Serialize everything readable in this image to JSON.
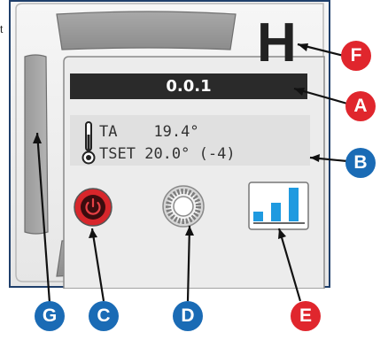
{
  "edge_text": "t",
  "display": {
    "title": "0.0.1",
    "mode_letter": "H",
    "sensors": {
      "ta_label": "TA",
      "ta_value": "19.4°",
      "tset_label": "TSET",
      "tset_value": "20.0°",
      "tset_offset": "(-4)"
    },
    "signal_bars": 3
  },
  "callouts": {
    "a": "A",
    "b": "B",
    "c": "C",
    "d": "D",
    "e": "E",
    "f": "F",
    "g": "G"
  },
  "colors": {
    "callout_red": "#e0262d",
    "callout_blue": "#1a6bb5",
    "power_red": "#d7262b",
    "signal_blue": "#1f9ae0",
    "frame_navy": "#1f3f6b"
  },
  "icons": {
    "thermometer": "thermometer-icon",
    "power": "power-icon",
    "settings_wheel": "settings-wheel-icon",
    "signal": "signal-strength-icon"
  }
}
